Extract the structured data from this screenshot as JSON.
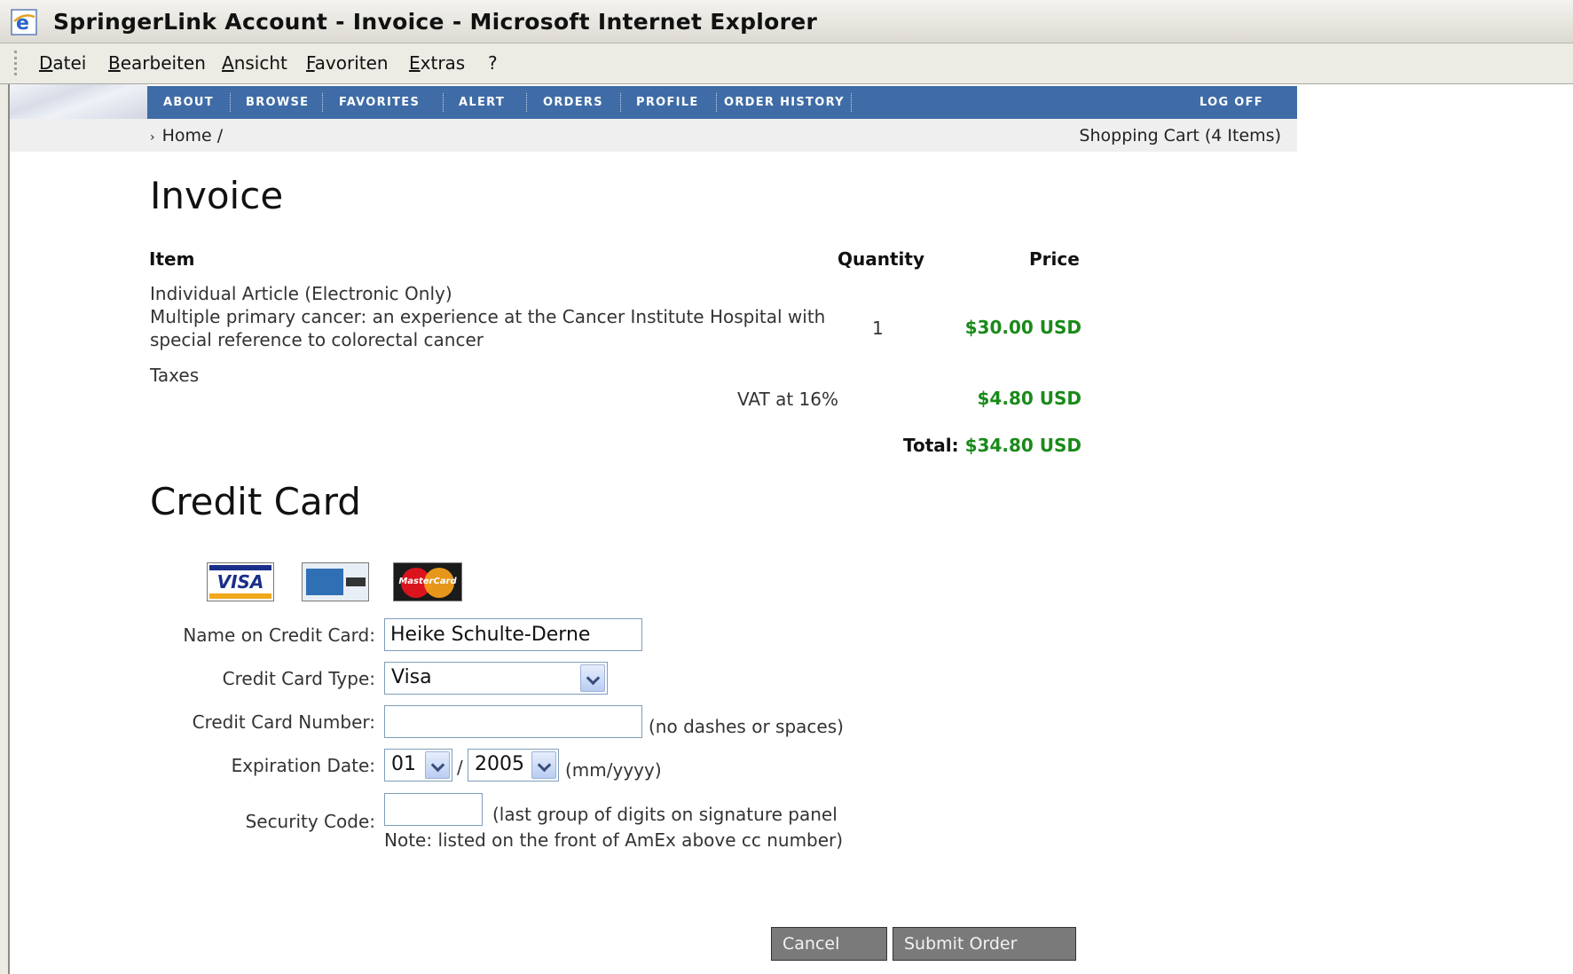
{
  "window": {
    "title": "SpringerLink Account - Invoice - Microsoft Internet Explorer",
    "icon": "ie-icon"
  },
  "menu": [
    "Datei",
    "Bearbeiten",
    "Ansicht",
    "Favoriten",
    "Extras",
    "?"
  ],
  "nav": {
    "items": [
      "ABOUT",
      "BROWSE",
      "FAVORITES",
      "ALERT",
      "ORDERS",
      "PROFILE",
      "ORDER HISTORY"
    ],
    "logoff": "LOG OFF",
    "color": "#3f6ca6"
  },
  "breadcrumb": {
    "home": "Home /"
  },
  "cart": "Shopping Cart (4 Items)",
  "invoice": {
    "title": "Invoice",
    "headers": {
      "item": "Item",
      "quantity": "Quantity",
      "price": "Price"
    },
    "line": {
      "type": "Individual Article (Electronic Only)",
      "title_line1": "Multiple primary cancer: an experience at the Cancer Institute Hospital with",
      "title_line2": "special reference to colorectal cancer",
      "quantity": "1",
      "price": "$30.00 USD"
    },
    "taxes_label": "Taxes",
    "vat_label": "VAT at 16%",
    "vat_amount": "$4.80 USD",
    "total_label": "Total:",
    "total_amount": "$34.80 USD",
    "money_color": "#1a8a1a"
  },
  "credit_card": {
    "title": "Credit Card",
    "logos": {
      "visa": "VISA",
      "mastercard": "MasterCard"
    },
    "name_label": "Name on Credit Card:",
    "name_value": "Heike Schulte-Derne",
    "type_label": "Credit Card Type:",
    "type_value": "Visa",
    "number_label": "Credit Card Number:",
    "number_value": "",
    "number_hint": "(no dashes or spaces)",
    "exp_label": "Expiration Date:",
    "exp_month": "01",
    "exp_sep": "/",
    "exp_year": "2005",
    "exp_hint": "(mm/yyyy)",
    "security_label": "Security Code:",
    "security_value": "",
    "security_hint1": "(last group of digits on signature panel",
    "security_hint2": "Note: listed on the front of AmEx above cc number)"
  },
  "buttons": {
    "cancel": "Cancel",
    "submit": "Submit Order"
  }
}
